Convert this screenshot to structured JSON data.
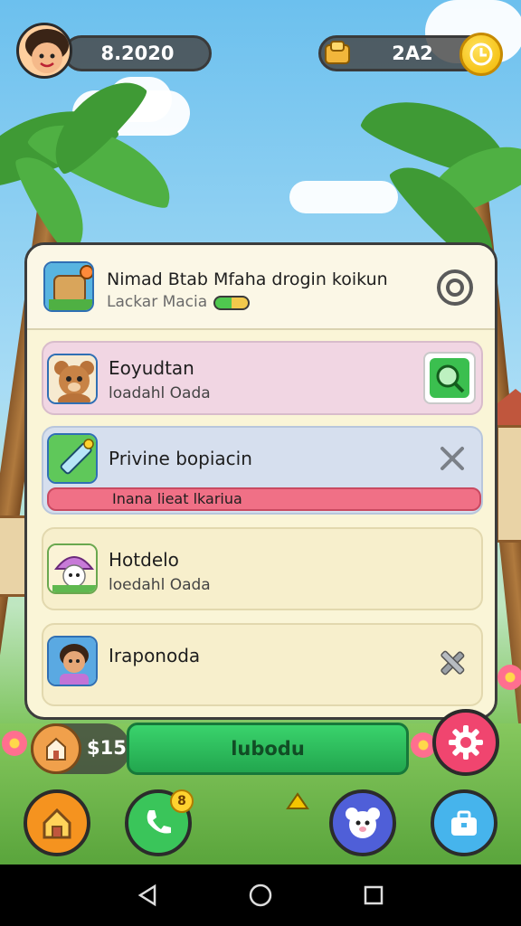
{
  "hud": {
    "player_score": "8.2020",
    "currency": "2A2"
  },
  "panel": {
    "header": {
      "title": "Nimad Btab Mfaha drogin koikun",
      "subtitle": "Lackar Macia"
    },
    "items": [
      {
        "title": "Eoyudtan",
        "subtitle": "loadahl Oada",
        "bg": "#f1d6e3"
      },
      {
        "title": "Privine bopiacin",
        "banner": "Inana lieat lkariua",
        "bg": "#d6dfee"
      },
      {
        "title": "Hotdelo",
        "subtitle": "loedahl Oada",
        "bg": "#f7efcc"
      },
      {
        "title": "Iraponoda",
        "bg": "#f7efcc"
      }
    ]
  },
  "bottom": {
    "price": "$15",
    "action_label": "lubodu",
    "phone_badge": "8"
  },
  "colors": {
    "accent_green": "#2fbf5c",
    "accent_pink": "#f07086",
    "settings_pink": "#f0456f"
  }
}
